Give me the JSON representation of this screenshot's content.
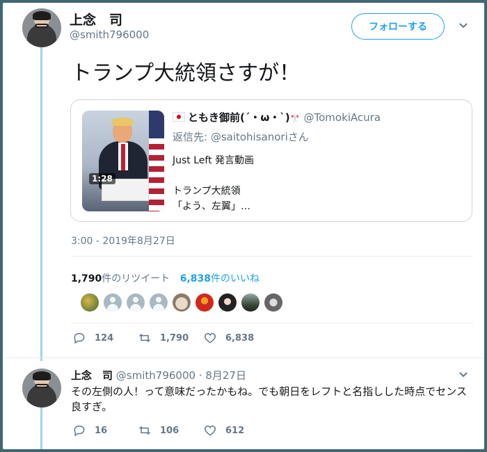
{
  "main_tweet": {
    "display_name": "上念　司",
    "handle": "@smith796000",
    "follow_label": "フォローする",
    "text": "トランプ大統領さすが！",
    "quote": {
      "author_name": "ともき御前(´・ω・`)",
      "author_suffix_emoji": "🎌",
      "author_handle": "@TomokiAcura",
      "reply_to": "返信先: @saitohisanoriさん",
      "video_duration": "1:28",
      "text_line1": "Just Left 発言動画",
      "text_line2": "トランプ大統領",
      "text_line3": "「よう、左翼」…"
    },
    "timestamp": "3:00 - 2019年8月27日",
    "retweets_count": "1,790",
    "retweets_label": "件のリツイート",
    "likes_count": "6,838",
    "likes_label": "件のいいね",
    "likers_count": 9,
    "actions": {
      "replies": "124",
      "retweets": "1,790",
      "likes": "6,838"
    }
  },
  "reply_tweet": {
    "display_name": "上念　司",
    "handle_and_date": "@smith796000 · 8月27日",
    "text": "その左側の人！って意味だったかもね。でも朝日をレフトと名指しした時点でセンス良すぎ。",
    "actions": {
      "replies": "16",
      "retweets": "106",
      "likes": "612"
    }
  },
  "colors": {
    "accent": "#1da1f2",
    "thread_line": "#9fd3f0",
    "muted": "#657786"
  }
}
